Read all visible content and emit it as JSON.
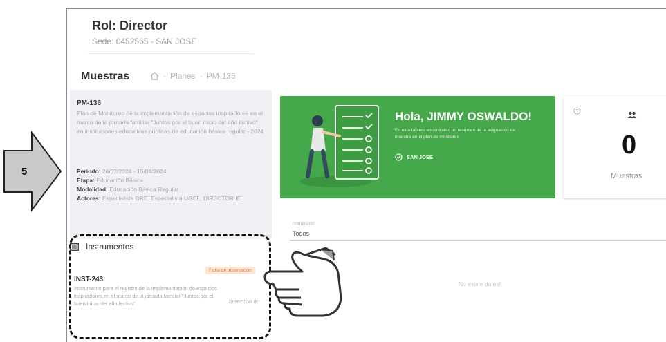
{
  "step": {
    "number": "5"
  },
  "header": {
    "role": "Rol: Director",
    "sede": "Sede: 0452565 - SAN JOSE"
  },
  "breadcrumb": {
    "section": "Muestras",
    "planes": "Planes",
    "current": "PM-136"
  },
  "plan": {
    "code": "PM-136",
    "description": "Plan de Monitoreo de la implementación de espacios inspiradores en el marco de la jornada familiar \"Juntos por el buen inicio del año lectivo\" en instituciones educativas públicas de educación básica regular - 2024",
    "periodo_label": "Periodo:",
    "periodo": "26/02/2024 - 15/04/2024",
    "etapa_label": "Etapa:",
    "etapa": "Educación Básica",
    "modalidad_label": "Modalidad:",
    "modalidad": "Educación Básica Regular",
    "actores_label": "Actores:",
    "actores": "Especialista DRE, Especialista UGEL, DIRECTOR IE"
  },
  "welcome": {
    "greeting": "Hola, JIMMY OSWALDO!",
    "message": "En esta tablero encontrarás un resumen de la asignación de muestra en el plan de monitoreo",
    "sede": "SAN JOSE"
  },
  "stats": {
    "count": "0",
    "label": "Muestras"
  },
  "filter": {
    "label": "Instrumento",
    "value": "Todos"
  },
  "empty_message": "No existe datos!",
  "instruments": {
    "title": "Instrumentos",
    "items": [
      {
        "badge": "Ficha de observación",
        "code": "INST-243",
        "description": "Instrumento para el registro de la implementación de espacios inspiradores en el marco de la jornada familiar \"Juntos por el buen inicio del año lectivo\"",
        "role": "DIRECTOR IE"
      }
    ]
  },
  "colors": {
    "welcome_bg": "#45a84b",
    "badge_bg": "#fde7d6",
    "badge_text": "#e07a3c",
    "panel_bg": "#eef0f3"
  }
}
